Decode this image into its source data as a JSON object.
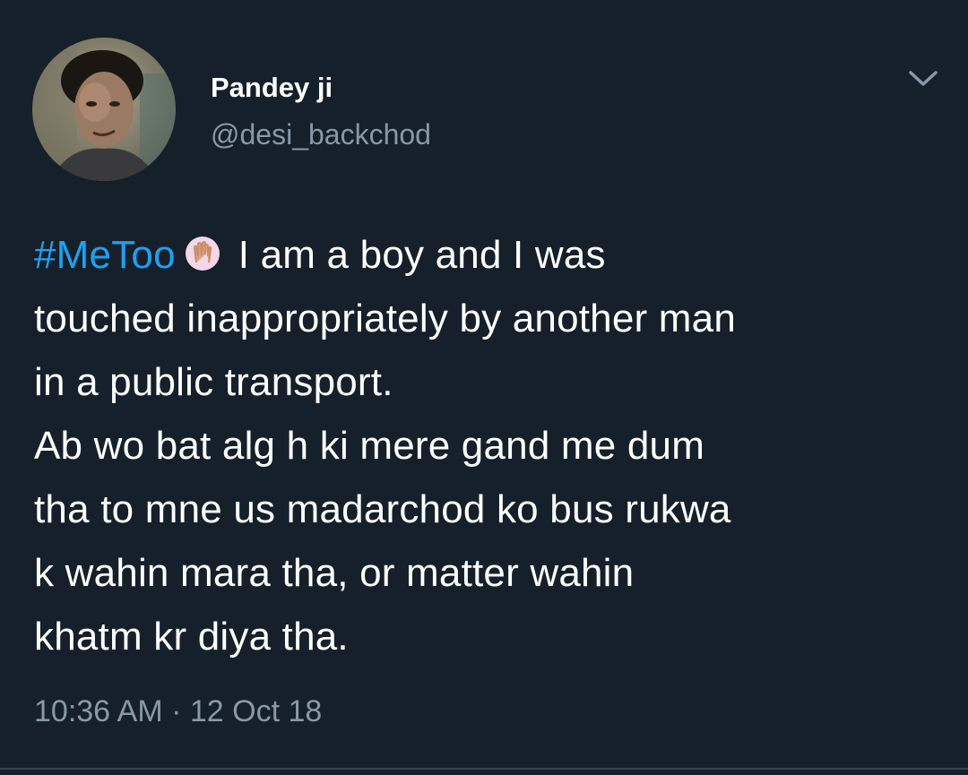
{
  "user": {
    "display_name": "Pandey ji",
    "handle": "@desi_backchod"
  },
  "tweet": {
    "hashtag": "#MeToo",
    "emoji": "raised-hands-emoji",
    "lines": [
      "I am a boy and I was",
      "touched inappropriately by another man",
      "in a public transport.",
      "Ab wo bat alg h ki mere gand me dum",
      "tha to mne us madarchod ko bus rukwa",
      "k wahin mara tha, or matter wahin",
      "khatm kr diya tha."
    ],
    "time": "10:36 AM",
    "separator": "·",
    "date": "12 Oct 18"
  },
  "colors": {
    "background": "#15202b",
    "text": "#ffffff",
    "secondary": "#8899a6",
    "link": "#1da1f2"
  },
  "icons": {
    "menu": "chevron-down-icon",
    "avatar": "avatar"
  }
}
